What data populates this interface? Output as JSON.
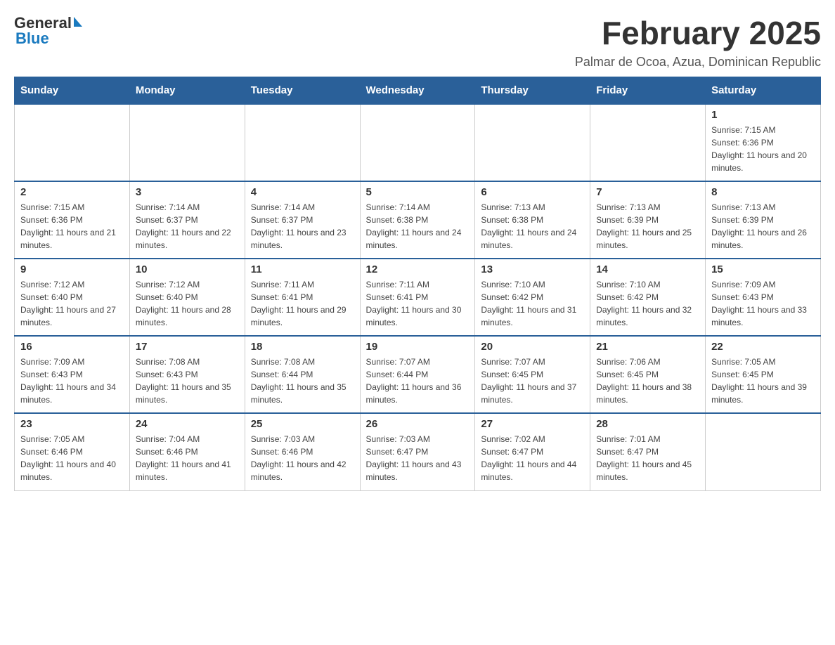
{
  "header": {
    "title": "February 2025",
    "subtitle": "Palmar de Ocoa, Azua, Dominican Republic",
    "logo_general": "General",
    "logo_blue": "Blue"
  },
  "weekdays": [
    "Sunday",
    "Monday",
    "Tuesday",
    "Wednesday",
    "Thursday",
    "Friday",
    "Saturday"
  ],
  "weeks": [
    {
      "days": [
        {
          "number": "",
          "info": ""
        },
        {
          "number": "",
          "info": ""
        },
        {
          "number": "",
          "info": ""
        },
        {
          "number": "",
          "info": ""
        },
        {
          "number": "",
          "info": ""
        },
        {
          "number": "",
          "info": ""
        },
        {
          "number": "1",
          "info": "Sunrise: 7:15 AM\nSunset: 6:36 PM\nDaylight: 11 hours and 20 minutes."
        }
      ]
    },
    {
      "days": [
        {
          "number": "2",
          "info": "Sunrise: 7:15 AM\nSunset: 6:36 PM\nDaylight: 11 hours and 21 minutes."
        },
        {
          "number": "3",
          "info": "Sunrise: 7:14 AM\nSunset: 6:37 PM\nDaylight: 11 hours and 22 minutes."
        },
        {
          "number": "4",
          "info": "Sunrise: 7:14 AM\nSunset: 6:37 PM\nDaylight: 11 hours and 23 minutes."
        },
        {
          "number": "5",
          "info": "Sunrise: 7:14 AM\nSunset: 6:38 PM\nDaylight: 11 hours and 24 minutes."
        },
        {
          "number": "6",
          "info": "Sunrise: 7:13 AM\nSunset: 6:38 PM\nDaylight: 11 hours and 24 minutes."
        },
        {
          "number": "7",
          "info": "Sunrise: 7:13 AM\nSunset: 6:39 PM\nDaylight: 11 hours and 25 minutes."
        },
        {
          "number": "8",
          "info": "Sunrise: 7:13 AM\nSunset: 6:39 PM\nDaylight: 11 hours and 26 minutes."
        }
      ]
    },
    {
      "days": [
        {
          "number": "9",
          "info": "Sunrise: 7:12 AM\nSunset: 6:40 PM\nDaylight: 11 hours and 27 minutes."
        },
        {
          "number": "10",
          "info": "Sunrise: 7:12 AM\nSunset: 6:40 PM\nDaylight: 11 hours and 28 minutes."
        },
        {
          "number": "11",
          "info": "Sunrise: 7:11 AM\nSunset: 6:41 PM\nDaylight: 11 hours and 29 minutes."
        },
        {
          "number": "12",
          "info": "Sunrise: 7:11 AM\nSunset: 6:41 PM\nDaylight: 11 hours and 30 minutes."
        },
        {
          "number": "13",
          "info": "Sunrise: 7:10 AM\nSunset: 6:42 PM\nDaylight: 11 hours and 31 minutes."
        },
        {
          "number": "14",
          "info": "Sunrise: 7:10 AM\nSunset: 6:42 PM\nDaylight: 11 hours and 32 minutes."
        },
        {
          "number": "15",
          "info": "Sunrise: 7:09 AM\nSunset: 6:43 PM\nDaylight: 11 hours and 33 minutes."
        }
      ]
    },
    {
      "days": [
        {
          "number": "16",
          "info": "Sunrise: 7:09 AM\nSunset: 6:43 PM\nDaylight: 11 hours and 34 minutes."
        },
        {
          "number": "17",
          "info": "Sunrise: 7:08 AM\nSunset: 6:43 PM\nDaylight: 11 hours and 35 minutes."
        },
        {
          "number": "18",
          "info": "Sunrise: 7:08 AM\nSunset: 6:44 PM\nDaylight: 11 hours and 35 minutes."
        },
        {
          "number": "19",
          "info": "Sunrise: 7:07 AM\nSunset: 6:44 PM\nDaylight: 11 hours and 36 minutes."
        },
        {
          "number": "20",
          "info": "Sunrise: 7:07 AM\nSunset: 6:45 PM\nDaylight: 11 hours and 37 minutes."
        },
        {
          "number": "21",
          "info": "Sunrise: 7:06 AM\nSunset: 6:45 PM\nDaylight: 11 hours and 38 minutes."
        },
        {
          "number": "22",
          "info": "Sunrise: 7:05 AM\nSunset: 6:45 PM\nDaylight: 11 hours and 39 minutes."
        }
      ]
    },
    {
      "days": [
        {
          "number": "23",
          "info": "Sunrise: 7:05 AM\nSunset: 6:46 PM\nDaylight: 11 hours and 40 minutes."
        },
        {
          "number": "24",
          "info": "Sunrise: 7:04 AM\nSunset: 6:46 PM\nDaylight: 11 hours and 41 minutes."
        },
        {
          "number": "25",
          "info": "Sunrise: 7:03 AM\nSunset: 6:46 PM\nDaylight: 11 hours and 42 minutes."
        },
        {
          "number": "26",
          "info": "Sunrise: 7:03 AM\nSunset: 6:47 PM\nDaylight: 11 hours and 43 minutes."
        },
        {
          "number": "27",
          "info": "Sunrise: 7:02 AM\nSunset: 6:47 PM\nDaylight: 11 hours and 44 minutes."
        },
        {
          "number": "28",
          "info": "Sunrise: 7:01 AM\nSunset: 6:47 PM\nDaylight: 11 hours and 45 minutes."
        },
        {
          "number": "",
          "info": ""
        }
      ]
    }
  ]
}
